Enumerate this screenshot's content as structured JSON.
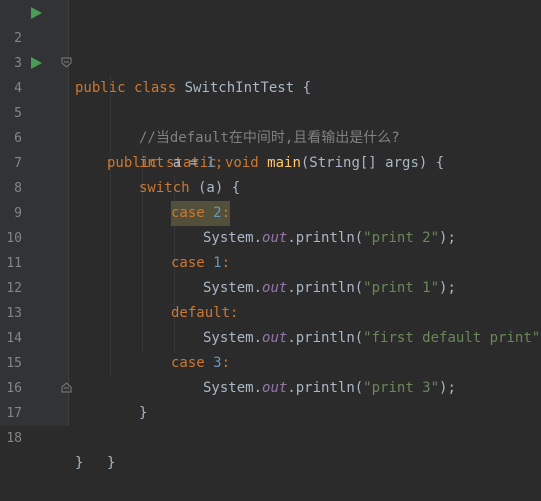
{
  "editor": {
    "lines": [
      {
        "num": "2",
        "tokens": {
          "kw1": "public class",
          "name": " SwitchIntTest {"
        }
      },
      {
        "num": "3"
      },
      {
        "num": "4",
        "tokens": {
          "kw1": "public static void",
          "fn": "main",
          "rest": "(String[] args) {"
        }
      },
      {
        "num": "5",
        "tokens": {
          "comment": "//当default在中间时,且看输出是什么?"
        }
      },
      {
        "num": "6",
        "tokens": {
          "kw1": "int",
          "mid": " a = ",
          "n": "1",
          "semi": ";"
        }
      },
      {
        "num": "7",
        "tokens": {
          "kw1": "switch",
          "rest": " (a) {"
        }
      },
      {
        "num": "8",
        "tokens": {
          "kw1": "case",
          "n": " 2",
          "colon": ":"
        }
      },
      {
        "num": "9",
        "tokens": {
          "a": "System.",
          "fld": "out",
          "b": ".println(",
          "s": "\"print 2\"",
          "c": ");"
        }
      },
      {
        "num": "10",
        "tokens": {
          "kw1": "case",
          "n": " 1",
          "colon": ":"
        }
      },
      {
        "num": "11",
        "tokens": {
          "a": "System.",
          "fld": "out",
          "b": ".println(",
          "s": "\"print 1\"",
          "c": ");"
        }
      },
      {
        "num": "12",
        "tokens": {
          "kw1": "default",
          "colon": ":"
        }
      },
      {
        "num": "13",
        "tokens": {
          "a": "System.",
          "fld": "out",
          "b": ".println(",
          "s": "\"first default print\"",
          "c": ");"
        }
      },
      {
        "num": "14",
        "tokens": {
          "kw1": "case",
          "n": " 3",
          "colon": ":"
        }
      },
      {
        "num": "15",
        "tokens": {
          "a": "System.",
          "fld": "out",
          "b": ".println(",
          "s": "\"print 3\"",
          "c": ");"
        }
      },
      {
        "num": "16",
        "tokens": {
          "brace": "}"
        }
      },
      {
        "num": "17",
        "tokens": {
          "brace": "}"
        }
      },
      {
        "num": "18",
        "tokens": {
          "brace": "}"
        }
      }
    ],
    "colors": {
      "background": "#2b2b2b",
      "gutter": "#313335",
      "keyword": "#cc7832",
      "function": "#ffc66d",
      "number": "#6897bb",
      "string": "#6a8759",
      "comment": "#808080",
      "field": "#9876aa",
      "run_marker": "#499c54",
      "highlight": "#52503a"
    },
    "gutter_icons": {
      "run": "run-arrow-icon",
      "fold": "fold-marker-icon"
    }
  }
}
